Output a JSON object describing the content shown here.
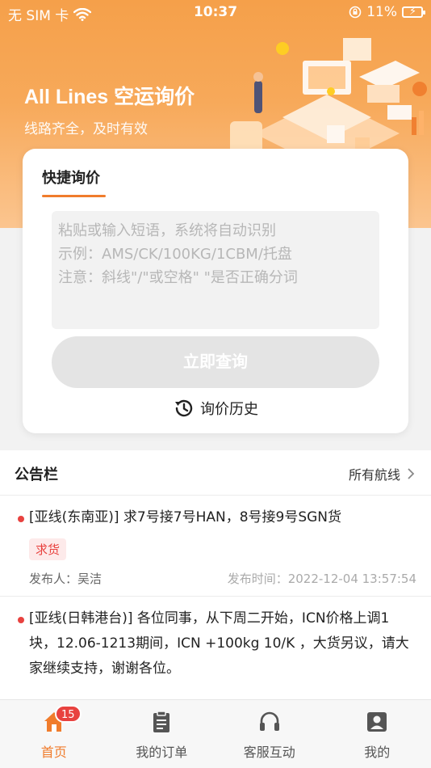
{
  "status_bar": {
    "carrier": "无 SIM 卡",
    "time": "10:37",
    "battery": "11%"
  },
  "header": {
    "title": "All Lines 空运询价",
    "subtitle": "线路齐全，及时有效"
  },
  "inquiry": {
    "tab_label": "快捷询价",
    "placeholder_lines": [
      "粘贴或输入短语，系统将自动识别",
      "示例：AMS/CK/100KG/1CBM/托盘",
      "注意：斜线\"/\"或空格\" \"是否正确分词"
    ],
    "submit_label": "立即查询",
    "history_label": "询价历史"
  },
  "bulletin": {
    "title": "公告栏",
    "all_routes_label": "所有航线",
    "posts": [
      {
        "text": "[亚线(东南亚)] 求7号接7号HAN，8号接9号SGN货",
        "tag": "求货",
        "publisher": "发布人：吴洁",
        "time": "发布时间：2022-12-04 13:57:54"
      },
      {
        "text": "[亚线(日韩港台)] 各位同事，从下周二开始，ICN价格上调1块，12.06-1213期间，ICN +100kg 10/K ，大货另议，请大家继续支持，谢谢各位。"
      }
    ]
  },
  "tabbar": {
    "home": {
      "label": "首页",
      "badge": "15"
    },
    "orders": {
      "label": "我的订单"
    },
    "service": {
      "label": "客服互动"
    },
    "mine": {
      "label": "我的"
    }
  },
  "colors": {
    "accent": "#f07c2c",
    "header": "#f5a04a",
    "badge": "#e8423f"
  }
}
